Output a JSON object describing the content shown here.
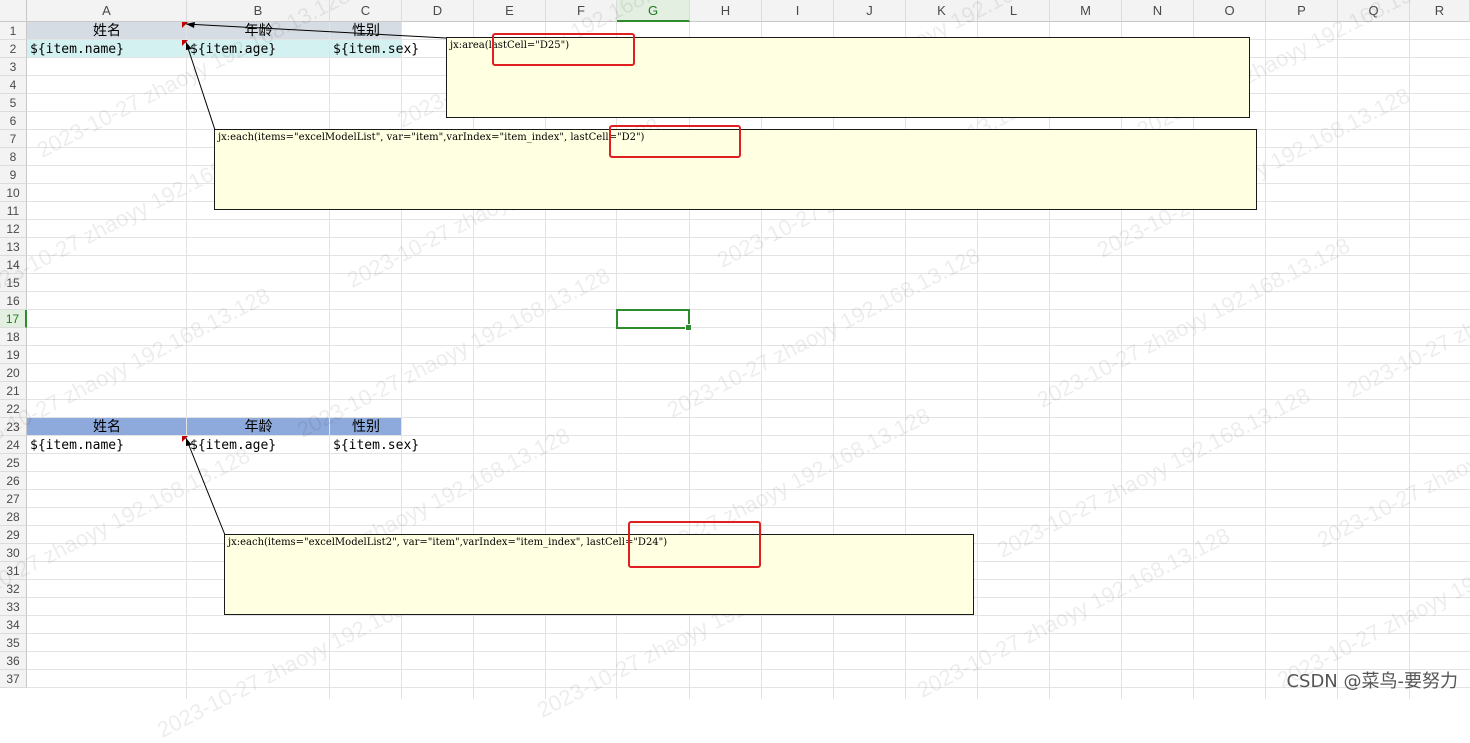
{
  "columns": [
    "A",
    "B",
    "C",
    "D",
    "E",
    "F",
    "G",
    "H",
    "I",
    "J",
    "K",
    "L",
    "M",
    "N",
    "O",
    "P",
    "Q",
    "R"
  ],
  "selected_column": "G",
  "rows": [
    "1",
    "2",
    "3",
    "4",
    "5",
    "6",
    "7",
    "8",
    "9",
    "10",
    "11",
    "12",
    "13",
    "14",
    "15",
    "16",
    "17",
    "18",
    "19",
    "20",
    "21",
    "22",
    "23",
    "24",
    "25",
    "26",
    "27",
    "28",
    "29",
    "30",
    "31",
    "32",
    "33",
    "34",
    "35",
    "36",
    "37"
  ],
  "selected_row": "17",
  "table1": {
    "header": {
      "name": "姓名",
      "age": "年龄",
      "sex": "性别"
    },
    "row": {
      "name": "${item.name}",
      "age": "${item.age}",
      "sex": "${item.sex}"
    }
  },
  "table2": {
    "header": {
      "name": "姓名",
      "age": "年龄",
      "sex": "性别"
    },
    "row": {
      "name": "${item.name}",
      "age": "${item.age}",
      "sex": "${item.sex}"
    }
  },
  "comments": {
    "area": "jx:area(lastCell=\"D25\")",
    "each1": "jx:each(items=\"excelModelList\", var=\"item\",varIndex=\"item_index\", lastCell=\"D2\")",
    "each2": "jx:each(items=\"excelModelList2\", var=\"item\",varIndex=\"item_index\", lastCell=\"D24\")"
  },
  "colors": {
    "table1_header_fill": "#d6dce4",
    "table1_row_fill": "#d4f1f2",
    "table2_header_fill": "#8ea9db",
    "note_fill": "#ffffe1",
    "highlight_box": "#e02020",
    "selection": "#2e8b2e"
  },
  "watermark": {
    "date": "2023-10-27",
    "user": "zhaoyy",
    "ip": "192.168.13.128"
  },
  "csdn_watermark": "CSDN @菜鸟-要努力"
}
